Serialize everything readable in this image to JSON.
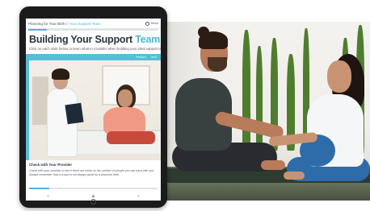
{
  "breadcrumb": {
    "course": "Planning for Your Birth",
    "separator": "//",
    "current": "Your Support Team"
  },
  "nav": {
    "label": "Menu",
    "button": "Play audio"
  },
  "progress": {
    "top_fraction": 0.14,
    "bottom_fraction": 0.16
  },
  "page": {
    "title_main": "Building Your Support",
    "title_accent": "Team",
    "instruction": "Click on each slide below to learn what to consider when building your ideal support team."
  },
  "slider": {
    "controls": [
      "Previous",
      "Next"
    ]
  },
  "caption": {
    "title": "Check with Your Provider",
    "text": "Check with your provider to see if there are limits on the number of people you can have with you. Always remember that a crowd is not always great for a peaceful birth."
  },
  "bottom_nav": [
    "<",
    "◉",
    ">"
  ],
  "colors": {
    "accent": "#4fb6d6",
    "title": "#2b3440",
    "device": "#1b1b1d"
  }
}
